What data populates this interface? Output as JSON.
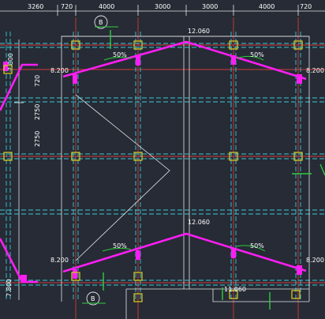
{
  "drawing": {
    "top_dimensions": [
      "3260",
      "720",
      "4000",
      "3000",
      "3000",
      "4000",
      "720"
    ],
    "left_dimensions": [
      "7.800",
      "720",
      "2750",
      "2750"
    ],
    "axis_bubbles": {
      "top": "B",
      "bottom": "B"
    },
    "ridge_elevations": {
      "top": "12.060",
      "bottom": "12.060"
    },
    "eave_elevations": {
      "top_left": "8.200",
      "top_right": "8.200",
      "bottom_left": "8.200",
      "bottom_right": "8.200"
    },
    "slopes": {
      "top_left": "50%",
      "top_right": "50%",
      "bottom_left": "50%",
      "bottom_right": "50%"
    },
    "bottom_left_elevation": "7.800",
    "bottom_elevation": "11.060",
    "colors": {
      "background": "#262b35",
      "grid_red": "#d43a3a",
      "dashed_cyan": "#39c9d6",
      "roof_magenta": "#ff1df5",
      "column_yellow": "#e0d020",
      "axis_green": "#2ecc40",
      "line_white": "#e6e6e6"
    }
  }
}
